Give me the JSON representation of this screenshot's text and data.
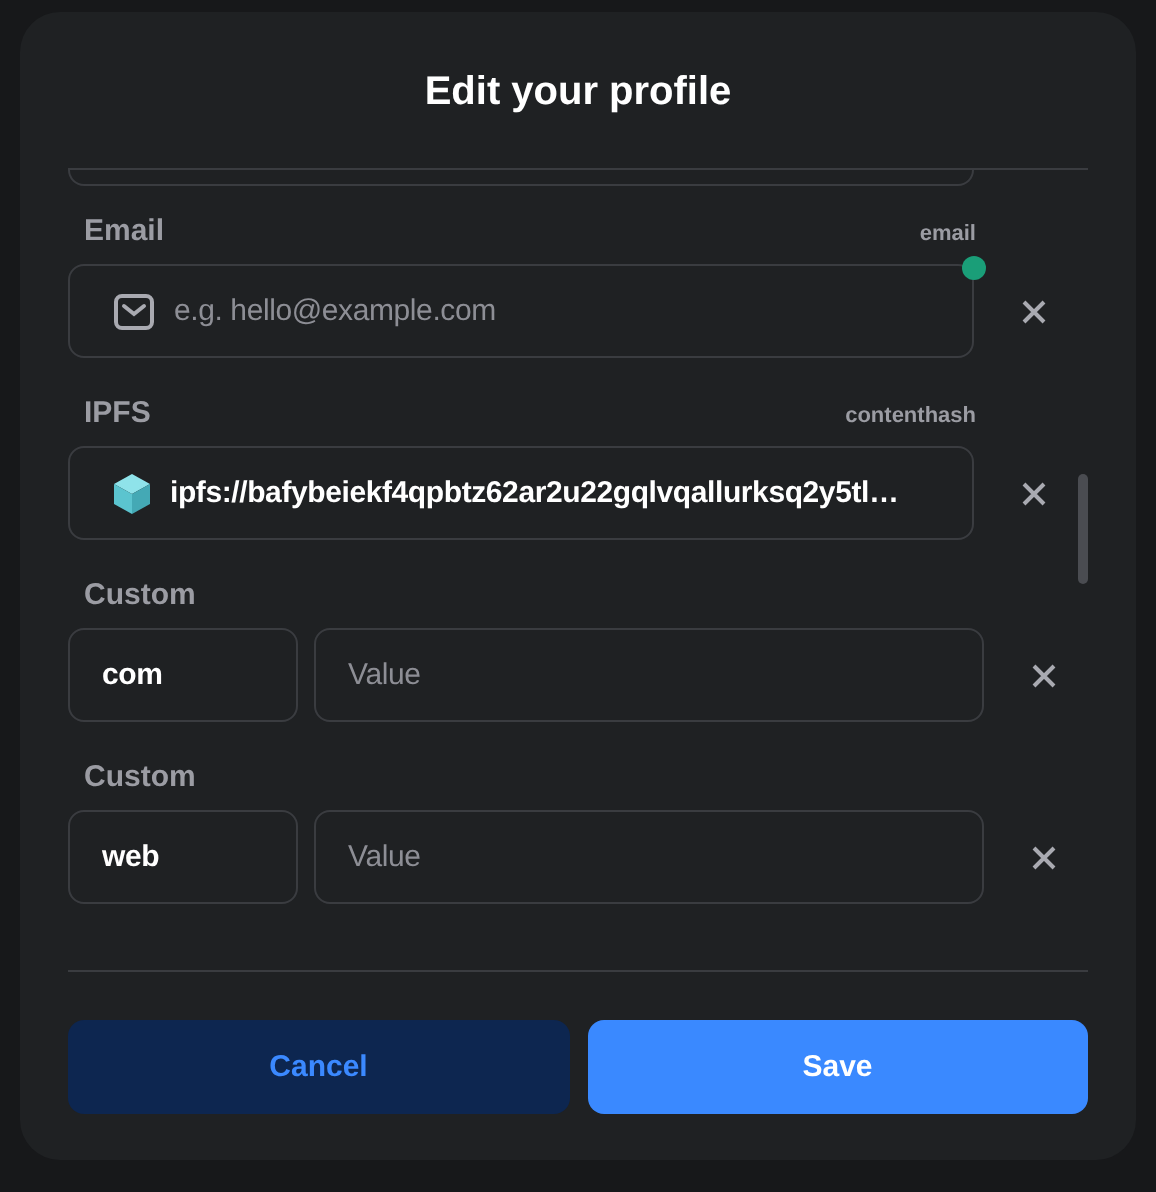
{
  "dialog": {
    "title": "Edit your profile"
  },
  "records": [
    {
      "kind": "email",
      "label": "Email",
      "tag": "email",
      "placeholder": "e.g. hello@example.com",
      "changed": true
    },
    {
      "kind": "ipfs",
      "label": "IPFS",
      "tag": "contenthash",
      "value": "ipfs://bafybeiekf4qpbtz62ar2u22gqlvqallurksq2y5tl…",
      "changed": false
    },
    {
      "kind": "custom",
      "label": "Custom",
      "key": "com",
      "placeholder": "Value"
    },
    {
      "kind": "custom",
      "label": "Custom",
      "key": "web",
      "placeholder": "Value"
    }
  ],
  "buttons": [
    {
      "kind": "secondary",
      "label": "Cancel"
    },
    {
      "kind": "primary",
      "label": "Save"
    }
  ]
}
